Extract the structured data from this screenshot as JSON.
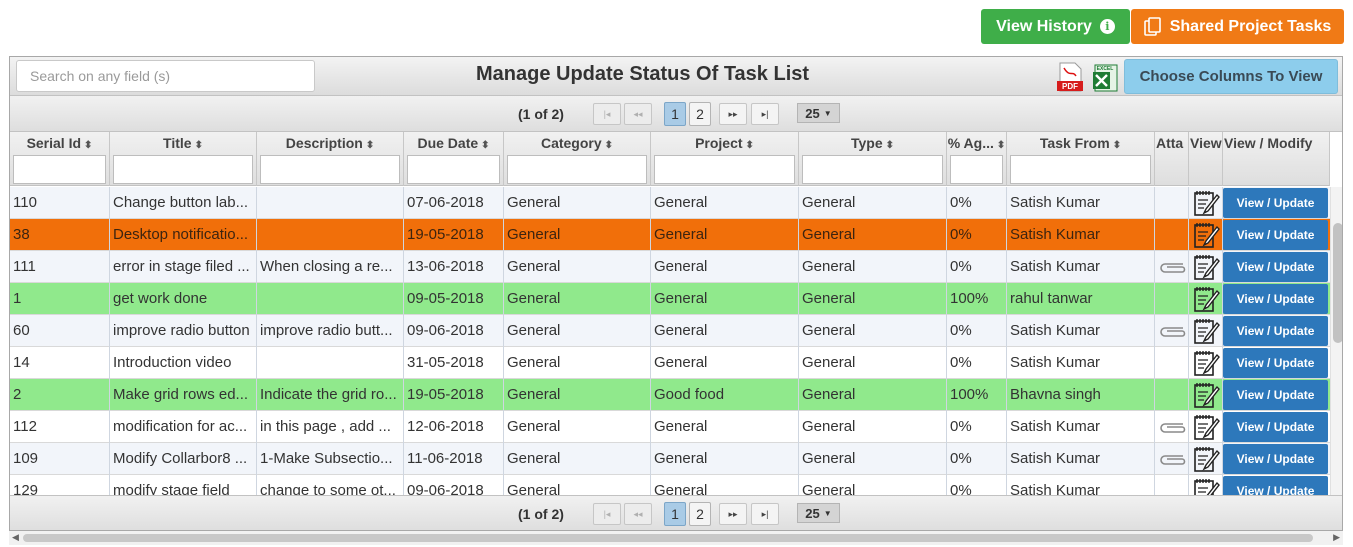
{
  "top_buttons": {
    "history": "View History",
    "shared": "Shared Project Tasks"
  },
  "header": {
    "search_placeholder": "Search on any field (s)",
    "title": "Manage Update Status Of Task List",
    "pdf_label": "PDF",
    "excel_label": "EXCEL",
    "choose_columns": "Choose Columns To View"
  },
  "pager": {
    "info": "(1 of 2)",
    "pages": [
      "1",
      "2"
    ],
    "current_page": "1",
    "page_size": "25"
  },
  "columns": [
    "Serial Id",
    "Title",
    "Description",
    "Due Date",
    "Category",
    "Project",
    "Type",
    "% Ag...",
    "Task From",
    "Atta",
    "View",
    "View / Modify"
  ],
  "action_label": "View / Update",
  "colors": {
    "accent_green": "#3fae49",
    "accent_orange": "#f07a16",
    "row_orange": "#f16f0a",
    "row_green": "#90e98c",
    "action_blue": "#2d78bb"
  },
  "rows": [
    {
      "serial": "110",
      "title": "Change button lab...",
      "description": "",
      "due": "07-06-2018",
      "category": "General",
      "project": "General",
      "type": "General",
      "pct": "0%",
      "from": "Satish Kumar",
      "attach": false,
      "style": "alt"
    },
    {
      "serial": "38",
      "title": "Desktop notificatio...",
      "description": "",
      "due": "19-05-2018",
      "category": "General",
      "project": "General",
      "type": "General",
      "pct": "0%",
      "from": "Satish Kumar",
      "attach": false,
      "style": "orange"
    },
    {
      "serial": "111",
      "title": "error in stage filed ...",
      "description": "When closing a re...",
      "due": "13-06-2018",
      "category": "General",
      "project": "General",
      "type": "General",
      "pct": "0%",
      "from": "Satish Kumar",
      "attach": true,
      "style": "alt"
    },
    {
      "serial": "1",
      "title": "get work done",
      "description": "",
      "due": "09-05-2018",
      "category": "General",
      "project": "General",
      "type": "General",
      "pct": "100%",
      "from": "rahul tanwar",
      "attach": false,
      "style": "green"
    },
    {
      "serial": "60",
      "title": "improve radio button",
      "description": "improve radio butt...",
      "due": "09-06-2018",
      "category": "General",
      "project": "General",
      "type": "General",
      "pct": "0%",
      "from": "Satish Kumar",
      "attach": true,
      "style": "alt"
    },
    {
      "serial": "14",
      "title": "Introduction video",
      "description": "",
      "due": "31-05-2018",
      "category": "General",
      "project": "General",
      "type": "General",
      "pct": "0%",
      "from": "Satish Kumar",
      "attach": false,
      "style": "white"
    },
    {
      "serial": "2",
      "title": "Make grid rows ed...",
      "description": "Indicate the grid ro...",
      "due": "19-05-2018",
      "category": "General",
      "project": "Good food",
      "type": "General",
      "pct": "100%",
      "from": "Bhavna singh",
      "attach": false,
      "style": "green"
    },
    {
      "serial": "112",
      "title": "modification for ac...",
      "description": "in this page , add ...",
      "due": "12-06-2018",
      "category": "General",
      "project": "General",
      "type": "General",
      "pct": "0%",
      "from": "Satish Kumar",
      "attach": true,
      "style": "white"
    },
    {
      "serial": "109",
      "title": "Modify Collarbor8 ...",
      "description": "1-Make Subsectio...",
      "due": "11-06-2018",
      "category": "General",
      "project": "General",
      "type": "General",
      "pct": "0%",
      "from": "Satish Kumar",
      "attach": true,
      "style": "alt"
    },
    {
      "serial": "129",
      "title": "modify stage field",
      "description": "change to some ot...",
      "due": "09-06-2018",
      "category": "General",
      "project": "General",
      "type": "General",
      "pct": "0%",
      "from": "Satish Kumar",
      "attach": false,
      "style": "white"
    }
  ]
}
